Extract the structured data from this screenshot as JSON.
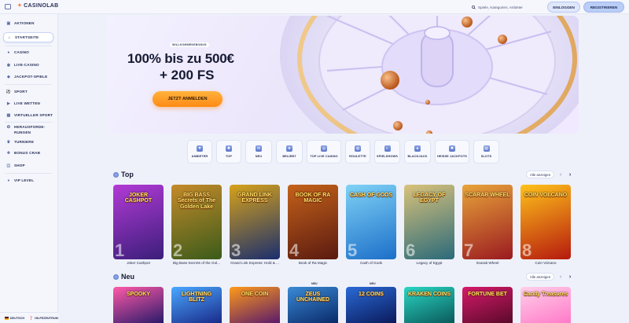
{
  "header": {
    "logo_text": "CASINOLAB",
    "search_placeholder": "Spiele, Kategorien, Anbieter",
    "login": "EINLOGGEN",
    "register": "REGISTRIEREN"
  },
  "sidebar": {
    "items": [
      {
        "label": "AKTIONEN",
        "icon": "gift-icon"
      },
      {
        "label": "STARTSEITE",
        "icon": "home-icon",
        "active": true
      },
      {
        "label": "CASINO",
        "icon": "cherry-icon"
      },
      {
        "label": "LIVE-CASINO",
        "icon": "live-icon"
      },
      {
        "label": "JACKPOT-SPIELE",
        "icon": "jackpot-icon"
      },
      {
        "label": "SPORT",
        "icon": "ball-icon"
      },
      {
        "label": "LIVE WETTEN",
        "icon": "live-bet-icon"
      },
      {
        "label": "VIRTUELLER SPORT",
        "icon": "virtual-icon"
      },
      {
        "label": "HERAUSFORDE-",
        "label2": "RUNGEN",
        "icon": "challenge-icon"
      },
      {
        "label": "TURNIERE",
        "icon": "trophy-icon"
      },
      {
        "label": "BONUS CRAB",
        "icon": "crab-icon"
      },
      {
        "label": "SHOP",
        "icon": "shop-icon"
      },
      {
        "label": "VIP LEVEL",
        "icon": "vip-icon"
      }
    ],
    "footer": {
      "language": "DEUTSCH",
      "help": "HILFEZENTRUM"
    }
  },
  "hero": {
    "badge": "WILLKOMMENSBONUS",
    "line1": "100% bis zu 500€",
    "line2": "+ 200 FS",
    "cta": "JETZT ANMELDEN"
  },
  "categories": [
    {
      "label": "ANBIETER",
      "icon": "filter-icon"
    },
    {
      "label": "TOP",
      "icon": "gear-icon"
    },
    {
      "label": "NEU",
      "icon": "new-icon"
    },
    {
      "label": "BELIEBT",
      "icon": "star-icon"
    },
    {
      "label": "TOP LIVE CASINO",
      "icon": "live-casino-icon"
    },
    {
      "label": "ROULETTE",
      "icon": "roulette-icon"
    },
    {
      "label": "SPIELSHOWS",
      "icon": "show-icon"
    },
    {
      "label": "BLACKJACK",
      "icon": "cards-icon"
    },
    {
      "label": "HEISSE JACKPOTS",
      "icon": "fire-icon"
    },
    {
      "label": "SLOTS",
      "icon": "slots-icon"
    }
  ],
  "sections": {
    "top": {
      "title": "Top",
      "show_all": "Alle anzeigen"
    },
    "new": {
      "title": "Neu",
      "show_all": "Alle anzeigen",
      "tag": "NEU"
    }
  },
  "top_games": [
    {
      "name": "Joker Cashpot",
      "art": "JOKER CASHPOT",
      "rank": "1",
      "bg1": "#3b1e7a",
      "bg2": "#b23ad6"
    },
    {
      "name": "Big Bass Secrets of the Gol...",
      "art": "BIG BASS Secrets of The Golden Lake",
      "rank": "2",
      "bg1": "#3a5b1a",
      "bg2": "#c48a2a"
    },
    {
      "name": "Grand Link Express: Hold & ...",
      "art": "GRAND LINK EXPRESS",
      "rank": "3",
      "bg1": "#1a2e6e",
      "bg2": "#d6a21a"
    },
    {
      "name": "Book of Ra Magic",
      "art": "BOOK OF RA MAGIC",
      "rank": "4",
      "bg1": "#5a1a10",
      "bg2": "#c4621a"
    },
    {
      "name": "Cash of Gods",
      "art": "CASH OF GODS",
      "rank": "5",
      "bg1": "#1c6fc9",
      "bg2": "#7fd2f5"
    },
    {
      "name": "Legacy of Egypt",
      "art": "LEGACY OF EGYPT",
      "rank": "6",
      "bg1": "#2a6a7a",
      "bg2": "#d9c27a"
    },
    {
      "name": "Scarab Wheel",
      "art": "SCARAB WHEEL",
      "rank": "7",
      "bg1": "#9a1a20",
      "bg2": "#e8a43a"
    },
    {
      "name": "Coin Volcano",
      "art": "COIN VOLCANO",
      "rank": "8",
      "bg1": "#b5190e",
      "bg2": "#ffc21a"
    }
  ],
  "new_games": [
    {
      "art": "SPOOKY",
      "bg1": "#2a1a6a",
      "bg2": "#ff5aa8"
    },
    {
      "art": "LIGHTNING BLITZ",
      "bg1": "#1a2a8a",
      "bg2": "#4aa8ff"
    },
    {
      "art": "ONE COIN",
      "bg1": "#5a1a6a",
      "bg2": "#ff9a1a"
    },
    {
      "art": "ZEUS UNCHAINED",
      "bg1": "#0a2a6a",
      "bg2": "#3a8ad6"
    },
    {
      "art": "12 COINS",
      "bg1": "#0a1a5a",
      "bg2": "#2a6ad6"
    },
    {
      "art": "KRAKEN COINS",
      "bg1": "#0a5a5a",
      "bg2": "#2ad6c4"
    },
    {
      "art": "FORTUNE BET",
      "bg1": "#5a0a2a",
      "bg2": "#d61a6a"
    },
    {
      "art": "Candy Treasures",
      "bg1": "#ff7ac8",
      "bg2": "#ffd0ea"
    }
  ]
}
